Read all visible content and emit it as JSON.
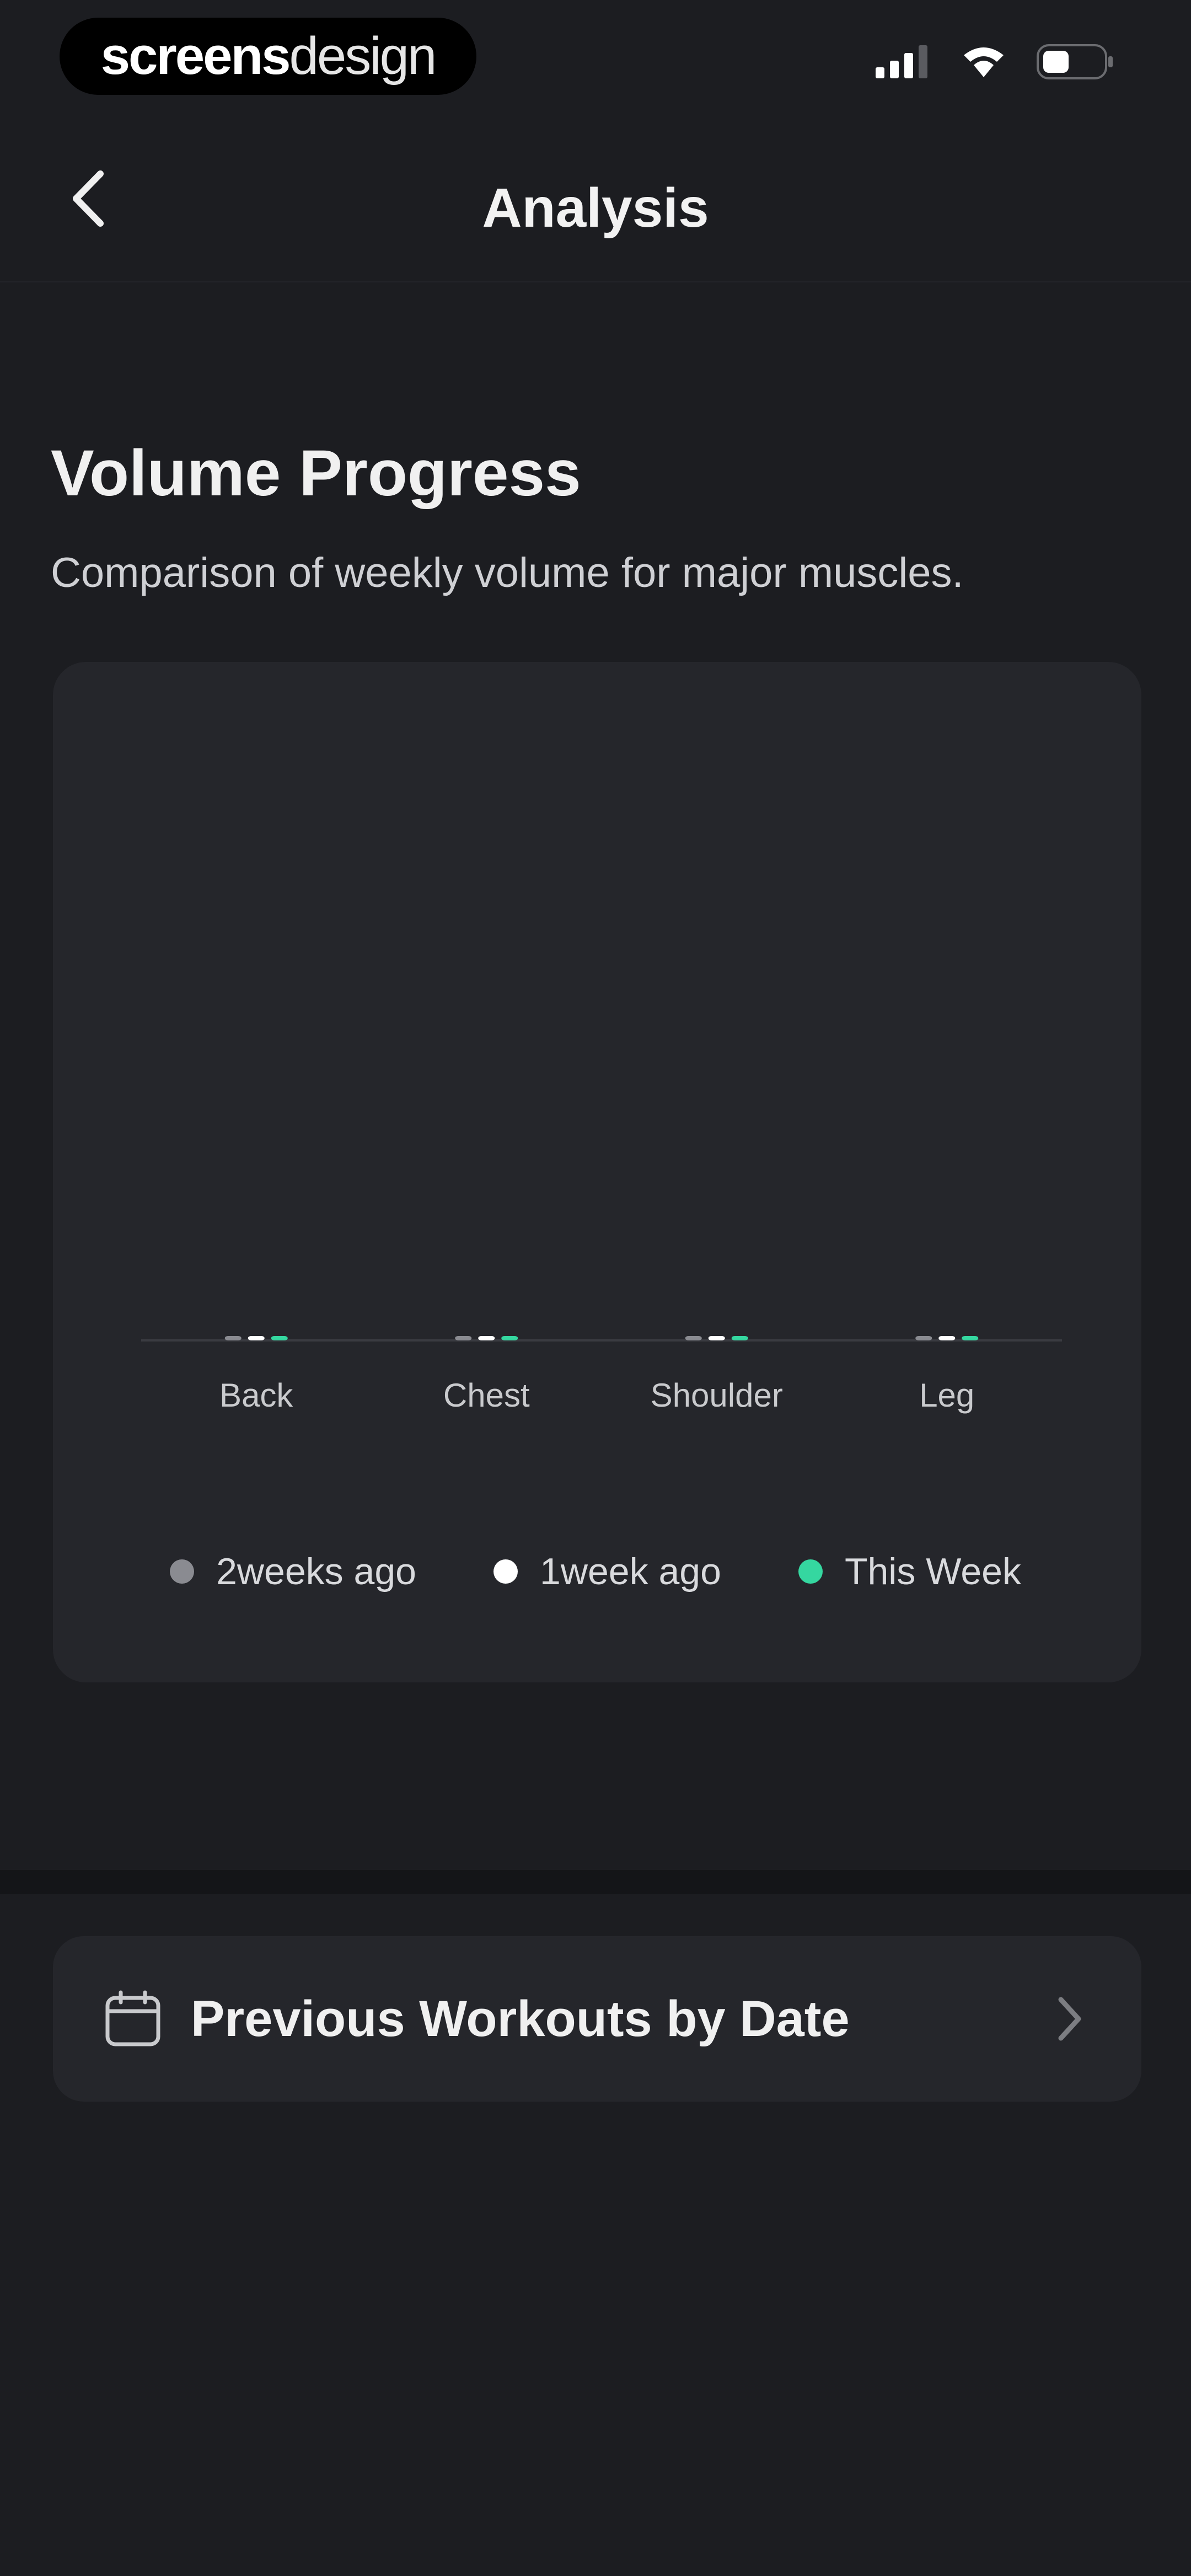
{
  "status_bar": {
    "brand_part1": "screens",
    "brand_part2": "design",
    "icons": [
      "signal-icon",
      "wifi-icon",
      "battery-icon"
    ]
  },
  "nav": {
    "title": "Analysis",
    "back_icon": "chevron-left-icon"
  },
  "section": {
    "title": "Volume Progress",
    "subtitle": "Comparison of weekly volume for major muscles."
  },
  "chart_data": {
    "type": "bar",
    "categories": [
      "Back",
      "Chest",
      "Shoulder",
      "Leg"
    ],
    "series": [
      {
        "name": "2weeks ago",
        "color": "#8a8b91",
        "values": [
          0,
          0,
          0,
          0
        ]
      },
      {
        "name": "1week ago",
        "color": "#ffffff",
        "values": [
          0,
          0,
          0,
          0
        ]
      },
      {
        "name": "This Week",
        "color": "#35d7a0",
        "values": [
          0,
          0,
          0,
          0
        ]
      }
    ],
    "title": "",
    "xlabel": "",
    "ylabel": "",
    "grid": false,
    "legend_position": "bottom"
  },
  "bottom": {
    "workouts_label": "Previous Workouts by Date",
    "icon": "calendar-icon",
    "chevron": "chevron-right-icon"
  },
  "colors": {
    "background": "#1c1d21",
    "card": "#25262b",
    "accent": "#35d7a0"
  }
}
